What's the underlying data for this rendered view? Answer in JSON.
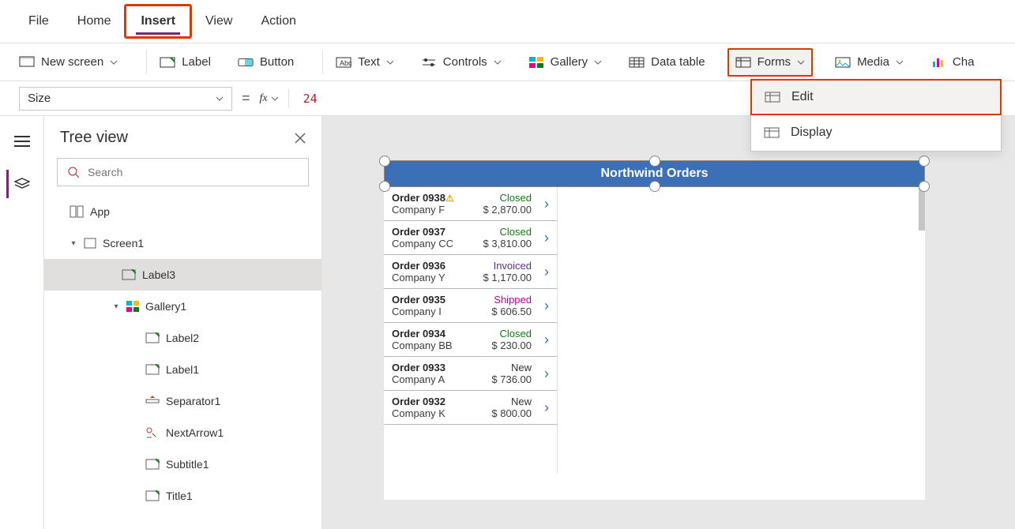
{
  "menu": {
    "file": "File",
    "home": "Home",
    "insert": "Insert",
    "view": "View",
    "action": "Action"
  },
  "ribbon": {
    "new_screen": "New screen",
    "label": "Label",
    "button": "Button",
    "text": "Text",
    "controls": "Controls",
    "gallery": "Gallery",
    "data_table": "Data table",
    "forms": "Forms",
    "media": "Media",
    "cha": "Cha"
  },
  "forms_menu": {
    "edit": "Edit",
    "display": "Display"
  },
  "formula": {
    "property": "Size",
    "value": "24"
  },
  "tree": {
    "title": "Tree view",
    "search_placeholder": "Search",
    "items": {
      "app": "App",
      "screen1": "Screen1",
      "label3": "Label3",
      "gallery1": "Gallery1",
      "label2": "Label2",
      "label1": "Label1",
      "separator1": "Separator1",
      "nextarrow1": "NextArrow1",
      "subtitle1": "Subtitle1",
      "title1": "Title1"
    }
  },
  "app": {
    "title": "Northwind Orders",
    "orders": [
      {
        "id": "Order 0938",
        "warn": true,
        "status": "Closed",
        "company": "Company F",
        "amount": "$ 2,870.00"
      },
      {
        "id": "Order 0937",
        "warn": false,
        "status": "Closed",
        "company": "Company CC",
        "amount": "$ 3,810.00"
      },
      {
        "id": "Order 0936",
        "warn": false,
        "status": "Invoiced",
        "company": "Company Y",
        "amount": "$ 1,170.00"
      },
      {
        "id": "Order 0935",
        "warn": false,
        "status": "Shipped",
        "company": "Company I",
        "amount": "$ 606.50"
      },
      {
        "id": "Order 0934",
        "warn": false,
        "status": "Closed",
        "company": "Company BB",
        "amount": "$ 230.00"
      },
      {
        "id": "Order 0933",
        "warn": false,
        "status": "New",
        "company": "Company A",
        "amount": "$ 736.00"
      },
      {
        "id": "Order 0932",
        "warn": false,
        "status": "New",
        "company": "Company K",
        "amount": "$ 800.00"
      }
    ]
  }
}
